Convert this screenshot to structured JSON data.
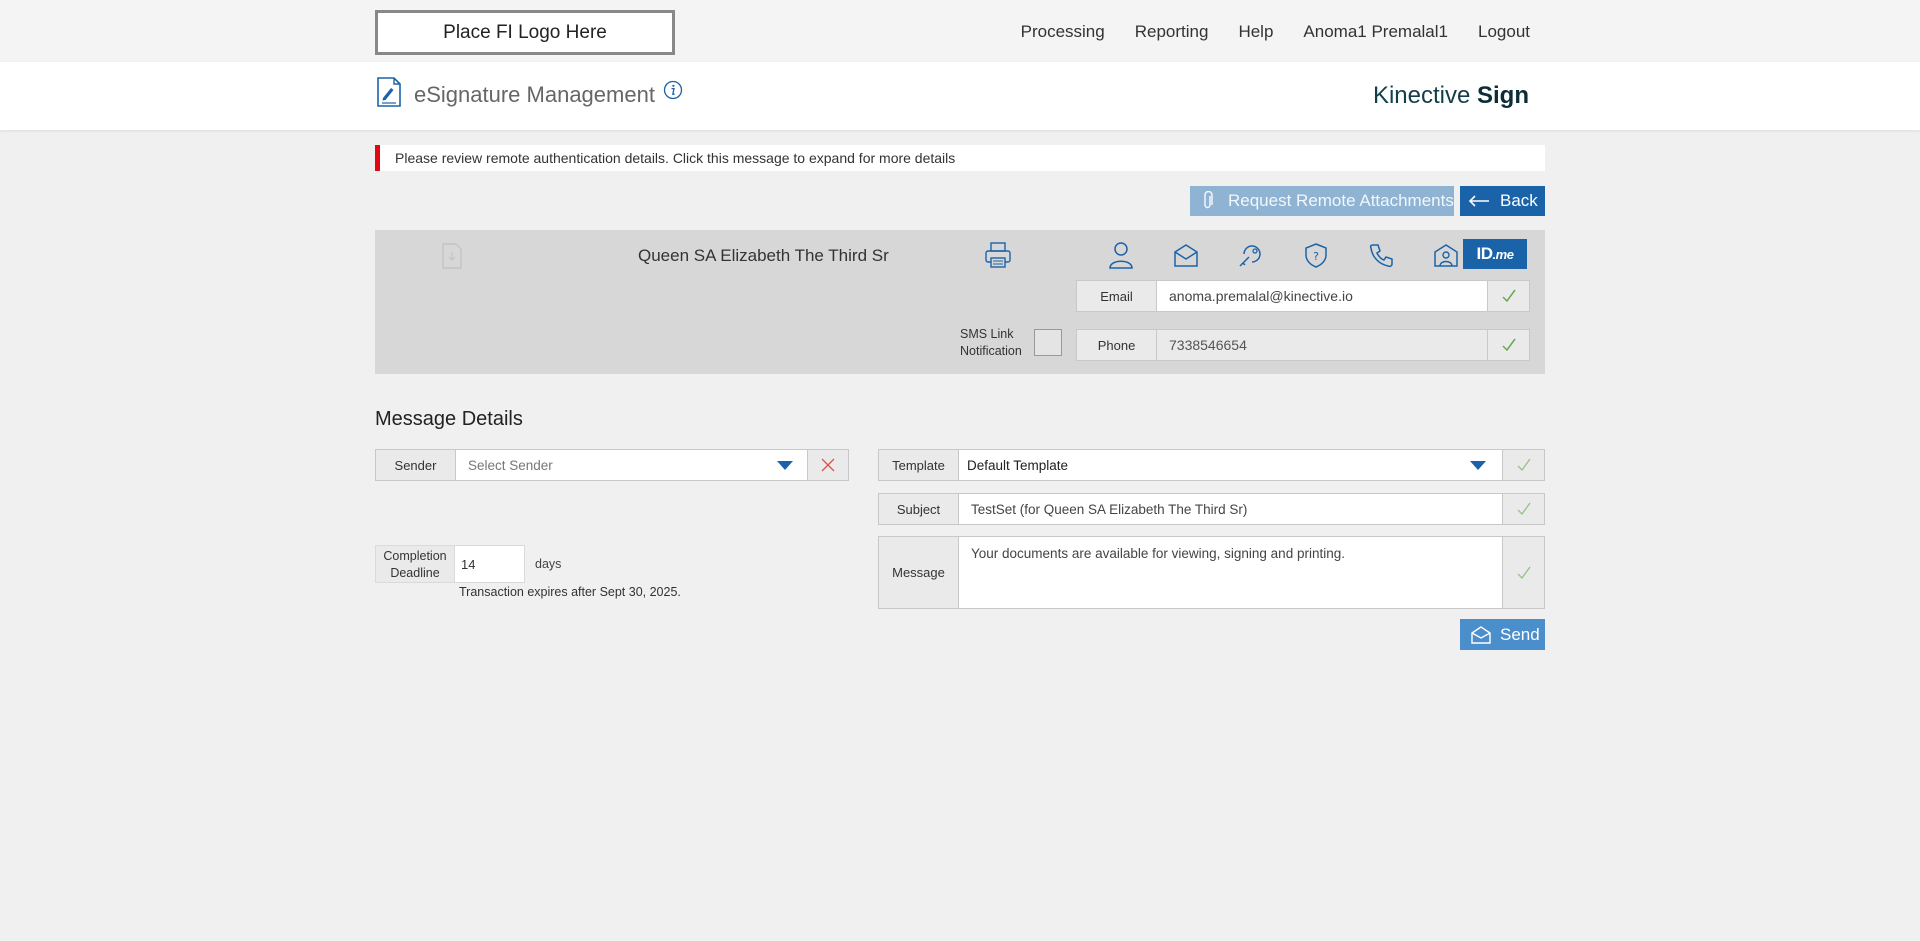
{
  "header": {
    "logo_placeholder": "Place FI Logo Here",
    "nav": [
      "Processing",
      "Reporting",
      "Help",
      "Anoma1 Premalal1",
      "Logout"
    ]
  },
  "app": {
    "title": "eSignature Management",
    "brand_light": "Kinective",
    "brand_bold": "Sign"
  },
  "alert": {
    "text": "Please review remote authentication details. Click this message to expand for more details",
    "color": "#e30613"
  },
  "actions": {
    "request_attachments": "Request Remote Attachments",
    "back": "Back",
    "send": "Send"
  },
  "recipient": {
    "name": "Queen SA Elizabeth The Third Sr",
    "auth_methods": [
      "person-icon",
      "email-auth-icon",
      "key-auth-icon",
      "kba-shield-icon",
      "phone-auth-icon",
      "in-person-icon"
    ],
    "idme_label": "ID",
    "idme_suffix": ".me",
    "email_label": "Email",
    "email_value": "anoma.premalal@kinective.io",
    "phone_label": "Phone",
    "phone_value": "7338546654",
    "sms_label_line1": "SMS Link",
    "sms_label_line2": "Notification"
  },
  "message_details": {
    "title": "Message Details",
    "sender_label": "Sender",
    "sender_placeholder": "Select Sender",
    "template_label": "Template",
    "template_value": "Default Template",
    "subject_label": "Subject",
    "subject_value": "TestSet (for Queen SA Elizabeth The Third Sr)",
    "message_label": "Message",
    "message_value": "Your documents are available for viewing, signing and printing.",
    "deadline_label_line1": "Completion",
    "deadline_label_line2": "Deadline",
    "deadline_value": "14",
    "deadline_unit": "days",
    "deadline_note": "Transaction expires after Sept 30, 2025."
  },
  "colors": {
    "primary": "#1b63a8",
    "primary_light": "#8fb3d3",
    "check": "#6aa84f",
    "error_x": "#d9534f"
  }
}
